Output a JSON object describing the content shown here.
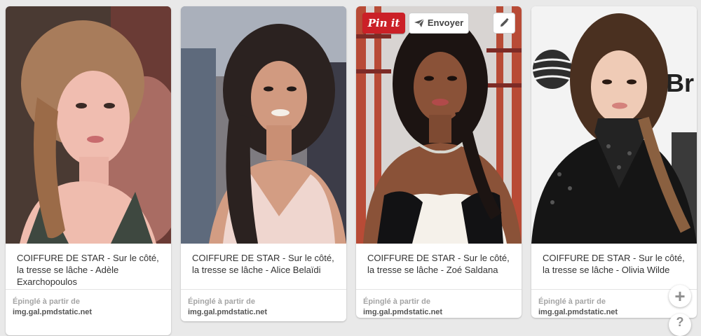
{
  "pins": [
    {
      "description": "COIFFURE DE STAR - Sur le côté, la tresse se lâche - Adèle Exarchopoulos",
      "attribution_prefix": "Épinglé à partir de",
      "attribution_source": "img.gal.pmdstatic.net",
      "image_alt": "woman-photo"
    },
    {
      "description": "COIFFURE DE STAR - Sur le côté, la tresse se lâche - Alice Belaïdi",
      "attribution_prefix": "Épinglé à partir de",
      "attribution_source": "img.gal.pmdstatic.net",
      "image_alt": "woman-photo"
    },
    {
      "description": "COIFFURE DE STAR - Sur le côté, la tresse se lâche - Zoé Saldana",
      "attribution_prefix": "Épinglé à partir de",
      "attribution_source": "img.gal.pmdstatic.net",
      "image_alt": "woman-photo"
    },
    {
      "description": "COIFFURE DE STAR - Sur le côté, la tresse se lâche - Olivia Wilde",
      "attribution_prefix": "Épinglé à partir de",
      "attribution_source": "img.gal.pmdstatic.net",
      "image_alt": "woman-photo"
    }
  ],
  "hover_actions": {
    "pinit_label": "Pin it",
    "send_label": "Envoyer",
    "edit_icon": "pencil-icon",
    "send_icon": "paper-plane-icon"
  },
  "floating": {
    "add_label": "+",
    "help_label": "?"
  },
  "photo_backdrop_text": "Br",
  "colors": {
    "pinit_red": "#cb2027",
    "page_bg": "#e9e9e9"
  }
}
